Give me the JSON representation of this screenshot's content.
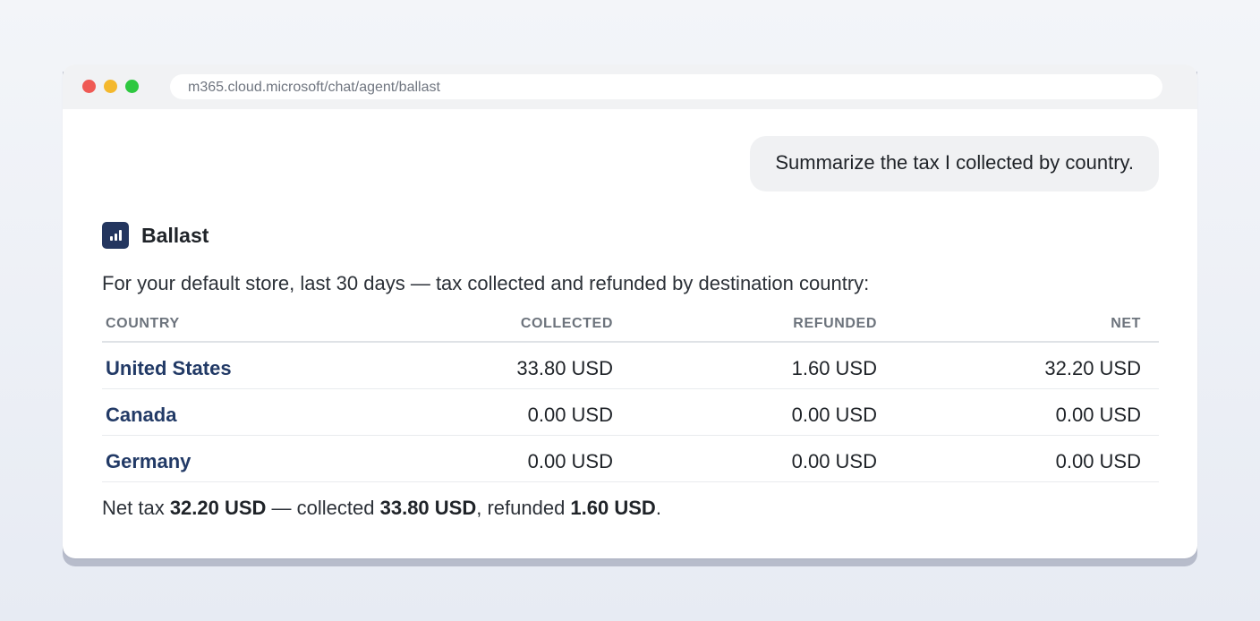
{
  "browser": {
    "url": "m365.cloud.microsoft/chat/agent/ballast"
  },
  "chat": {
    "user_message": "Summarize the tax I collected by country.",
    "agent_name": "Ballast",
    "agent_intro": "For your default store, last 30 days — tax collected and refunded by destination country:"
  },
  "table": {
    "headers": {
      "country": "COUNTRY",
      "collected": "COLLECTED",
      "refunded": "REFUNDED",
      "net": "NET"
    },
    "rows": [
      {
        "country": "United States",
        "collected": "33.80 USD",
        "refunded": "1.60 USD",
        "net": "32.20 USD"
      },
      {
        "country": "Canada",
        "collected": "0.00 USD",
        "refunded": "0.00 USD",
        "net": "0.00 USD"
      },
      {
        "country": "Germany",
        "collected": "0.00 USD",
        "refunded": "0.00 USD",
        "net": "0.00 USD"
      }
    ]
  },
  "summary": {
    "prefix": "Net tax ",
    "net_value": "32.20 USD",
    "mid1": " — collected ",
    "collected_value": "33.80 USD",
    "mid2": ", refunded ",
    "refunded_value": "1.60 USD",
    "suffix": "."
  },
  "colors": {
    "accent": "#223a66",
    "logo_bg": "#24365f",
    "dot_red": "#ef5a55",
    "dot_yellow": "#f4b82d",
    "dot_green": "#2ec840"
  },
  "icons": {
    "agent_logo": "bar-chart-icon"
  }
}
